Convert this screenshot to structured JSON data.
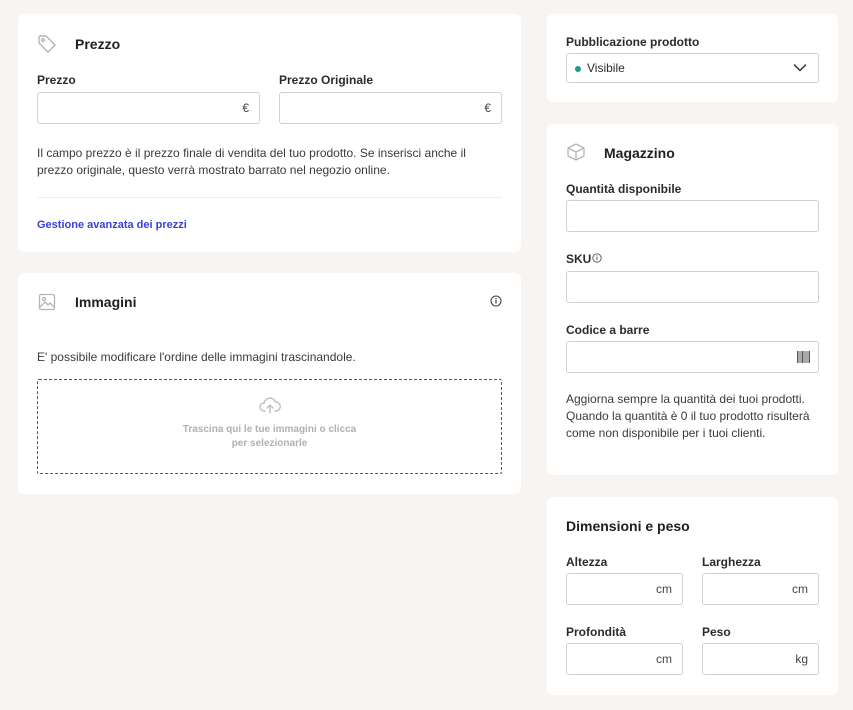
{
  "price": {
    "title": "Prezzo",
    "price_label": "Prezzo",
    "original_price_label": "Prezzo Originale",
    "currency_symbol": "€",
    "description": "Il campo prezzo è il prezzo finale di vendita del tuo prodotto. Se inserisci anche il prezzo originale, questo verrà mostrato barrato nel negozio online.",
    "advanced_link": "Gestione avanzata dei prezzi",
    "price_value": "",
    "original_price_value": ""
  },
  "images": {
    "title": "Immagini",
    "description": "E' possibile modificare l'ordine delle immagini trascinandole.",
    "dropzone_line1": "Trascina qui le tue immagini o clicca",
    "dropzone_line2": "per selezionarle"
  },
  "publication": {
    "label": "Pubblicazione prodotto",
    "selected": "Visibile",
    "status_color": "#1a9c8f"
  },
  "warehouse": {
    "title": "Magazzino",
    "quantity_label": "Quantità disponibile",
    "sku_label": "SKU",
    "barcode_label": "Codice a barre",
    "quantity_value": "",
    "sku_value": "",
    "barcode_value": "",
    "description": "Aggiorna sempre la quantità dei tuoi prodotti. Quando la quantità è 0 il tuo prodotto risulterà come non disponibile per i tuoi clienti."
  },
  "dimensions": {
    "title": "Dimensioni e peso",
    "height_label": "Altezza",
    "width_label": "Larghezza",
    "depth_label": "Profondità",
    "weight_label": "Peso",
    "length_unit": "cm",
    "weight_unit": "kg"
  },
  "colors": {
    "link": "#3b3fd8",
    "background": "#f7f4f1"
  }
}
